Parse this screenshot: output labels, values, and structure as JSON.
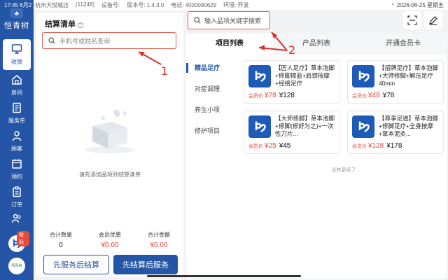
{
  "status": {
    "time": "17:45",
    "date": "6月2",
    "store": "杭州大悦城店",
    "store_id": "(11248)",
    "device": "设备号:",
    "version": "版本号: 1.4.3.0",
    "phone": "电话: 4000080629",
    "env": "环境: 开发",
    "datetime": "2026-06-25 星期五"
  },
  "brand": {
    "name": "恒青树"
  },
  "nav": [
    {
      "label": "收银",
      "icon": "monitor-icon"
    },
    {
      "label": "房间",
      "icon": "house-icon"
    },
    {
      "label": "服务单",
      "icon": "document-icon"
    },
    {
      "label": "顾客",
      "icon": "person-icon"
    },
    {
      "label": "预约",
      "icon": "calendar-icon"
    },
    {
      "label": "订单",
      "icon": "clipboard-icon"
    },
    {
      "label": "会员",
      "icon": "users-icon"
    }
  ],
  "help": {
    "tag": "帮助"
  },
  "avatar": {
    "text": "恒青树"
  },
  "settle": {
    "title": "结算清单",
    "search_placeholder": "手机号或姓名查询",
    "empty_text": "请先添加品项到结算清单",
    "totals": [
      {
        "label": "合计数量",
        "value": "0"
      },
      {
        "label": "会员优惠",
        "value": "¥0.00"
      },
      {
        "label": "合计金额",
        "value": "¥0.00"
      }
    ],
    "btn_service_first": "先服务后结算",
    "btn_settle_first": "先结算后服务"
  },
  "search": {
    "placeholder": "输入品项关键字搜索"
  },
  "tabs": [
    "项目列表",
    "产品列表",
    "开通会员卡"
  ],
  "categories": [
    "精品足疗",
    "对症调理",
    "养生小项",
    "修护项目"
  ],
  "products": [
    {
      "title": "【匠人足疗】草本泡脚+修脚擦盐+肩颈按摩+经络足疗",
      "member_label": "会员价",
      "member_price": "¥78",
      "price": "¥128"
    },
    {
      "title": "【招牌足疗】草本泡脚+大师修脚+解压足疗 40min",
      "member_label": "会员价",
      "member_price": "¥48",
      "price": "¥78"
    },
    {
      "title": "【大师修脚】草本泡脚+修脚(修好为之)+一次性刀片...",
      "member_label": "会员价",
      "member_price": "¥25",
      "price": "¥45"
    },
    {
      "title": "【尊享足道】草本泡脚+修脚足疗+全身按摩+草本泥灸...",
      "member_label": "会员价",
      "member_price": "¥128",
      "price": "¥178"
    }
  ],
  "no_more": "没有更多了",
  "annotations": {
    "one": "1",
    "two": "2"
  },
  "colors": {
    "nav": "#2555a6",
    "annotation": "#d9302b",
    "price_red": "#e8453c"
  }
}
